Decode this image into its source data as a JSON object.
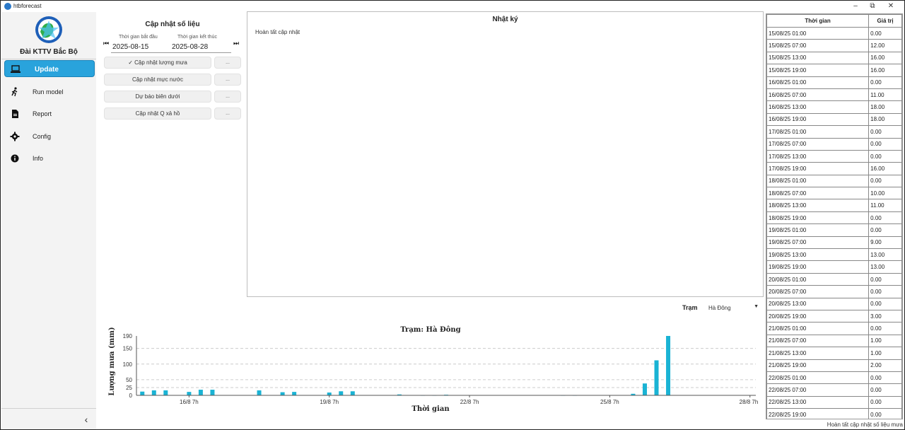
{
  "window": {
    "title": "htbforecast",
    "minimize_glyph": "–",
    "restore_glyph": "⧉",
    "close_glyph": "✕"
  },
  "sidebar": {
    "org_name": "Đài KTTV Bắc Bộ",
    "items": [
      {
        "label": "Update",
        "icon": "laptop-icon",
        "active": true
      },
      {
        "label": "Run model",
        "icon": "running-person-icon"
      },
      {
        "label": "Report",
        "icon": "document-icon"
      },
      {
        "label": "Config",
        "icon": "gear-icon"
      },
      {
        "label": "Info",
        "icon": "info-icon"
      }
    ],
    "collapse_glyph": "‹"
  },
  "update_panel": {
    "title": "Cập nhật số liệu",
    "start_label": "Thời gian bắt đầu",
    "end_label": "Thời gian kết thúc",
    "start_date": "2025-08-15",
    "end_date": "2025-08-28",
    "prev_glyph": "⏮",
    "next_glyph": "⏭",
    "buttons": [
      {
        "label": "✓ Cập nhật lượng mưa",
        "more": "..."
      },
      {
        "label": "Cập nhật mực nước",
        "more": "..."
      },
      {
        "label": "Dự báo biên dưới",
        "more": "..."
      },
      {
        "label": "Cập nhật Q xả hồ",
        "more": "..."
      }
    ]
  },
  "log": {
    "title": "Nhật ký",
    "lines": [
      "Hoàn tất cập nhật"
    ]
  },
  "station": {
    "label": "Trạm",
    "value": "Hà Đông"
  },
  "chart_data": {
    "type": "bar",
    "title": "Trạm: Hà Đông",
    "xlabel": "Thời gian",
    "ylabel": "Lượng mưa (mm)",
    "ylim": [
      0,
      190
    ],
    "yticks": [
      0,
      25,
      50,
      100,
      150,
      190
    ],
    "grid": "dashed horizontal",
    "bar_color": "#1ab3d4",
    "x_tick_labels": [
      "16/8 7h",
      "19/8 7h",
      "22/8 7h",
      "25/8 7h",
      "28/8 7h"
    ],
    "x_tick_index": [
      4,
      16,
      28,
      40,
      52
    ],
    "x_count": 53,
    "values": [
      12,
      16,
      16,
      0,
      11,
      18,
      18,
      0,
      0,
      0,
      16,
      0,
      10,
      11,
      0,
      0,
      9,
      13,
      13,
      0,
      0,
      0,
      3,
      0,
      1,
      1,
      2,
      0,
      0,
      0,
      0,
      0,
      0,
      0,
      0,
      0,
      1,
      1,
      0,
      0,
      0,
      0,
      5,
      38,
      112,
      190,
      0,
      0,
      0,
      0,
      0,
      0,
      0
    ]
  },
  "table": {
    "headers": [
      "Thời gian",
      "Giá trị"
    ],
    "rows": [
      [
        "15/08/25 01:00",
        "0.00"
      ],
      [
        "15/08/25 07:00",
        "12.00"
      ],
      [
        "15/08/25 13:00",
        "16.00"
      ],
      [
        "15/08/25 19:00",
        "16.00"
      ],
      [
        "16/08/25 01:00",
        "0.00"
      ],
      [
        "16/08/25 07:00",
        "11.00"
      ],
      [
        "16/08/25 13:00",
        "18.00"
      ],
      [
        "16/08/25 19:00",
        "18.00"
      ],
      [
        "17/08/25 01:00",
        "0.00"
      ],
      [
        "17/08/25 07:00",
        "0.00"
      ],
      [
        "17/08/25 13:00",
        "0.00"
      ],
      [
        "17/08/25 19:00",
        "16.00"
      ],
      [
        "18/08/25 01:00",
        "0.00"
      ],
      [
        "18/08/25 07:00",
        "10.00"
      ],
      [
        "18/08/25 13:00",
        "11.00"
      ],
      [
        "18/08/25 19:00",
        "0.00"
      ],
      [
        "19/08/25 01:00",
        "0.00"
      ],
      [
        "19/08/25 07:00",
        "9.00"
      ],
      [
        "19/08/25 13:00",
        "13.00"
      ],
      [
        "19/08/25 19:00",
        "13.00"
      ],
      [
        "20/08/25 01:00",
        "0.00"
      ],
      [
        "20/08/25 07:00",
        "0.00"
      ],
      [
        "20/08/25 13:00",
        "0.00"
      ],
      [
        "20/08/25 19:00",
        "3.00"
      ],
      [
        "21/08/25 01:00",
        "0.00"
      ],
      [
        "21/08/25 07:00",
        "1.00"
      ],
      [
        "21/08/25 13:00",
        "1.00"
      ],
      [
        "21/08/25 19:00",
        "2.00"
      ],
      [
        "22/08/25 01:00",
        "0.00"
      ],
      [
        "22/08/25 07:00",
        "0.00"
      ],
      [
        "22/08/25 13:00",
        "0.00"
      ],
      [
        "22/08/25 19:00",
        "0.00"
      ]
    ]
  },
  "status": "Hoàn tất cập nhật số liệu mưa"
}
